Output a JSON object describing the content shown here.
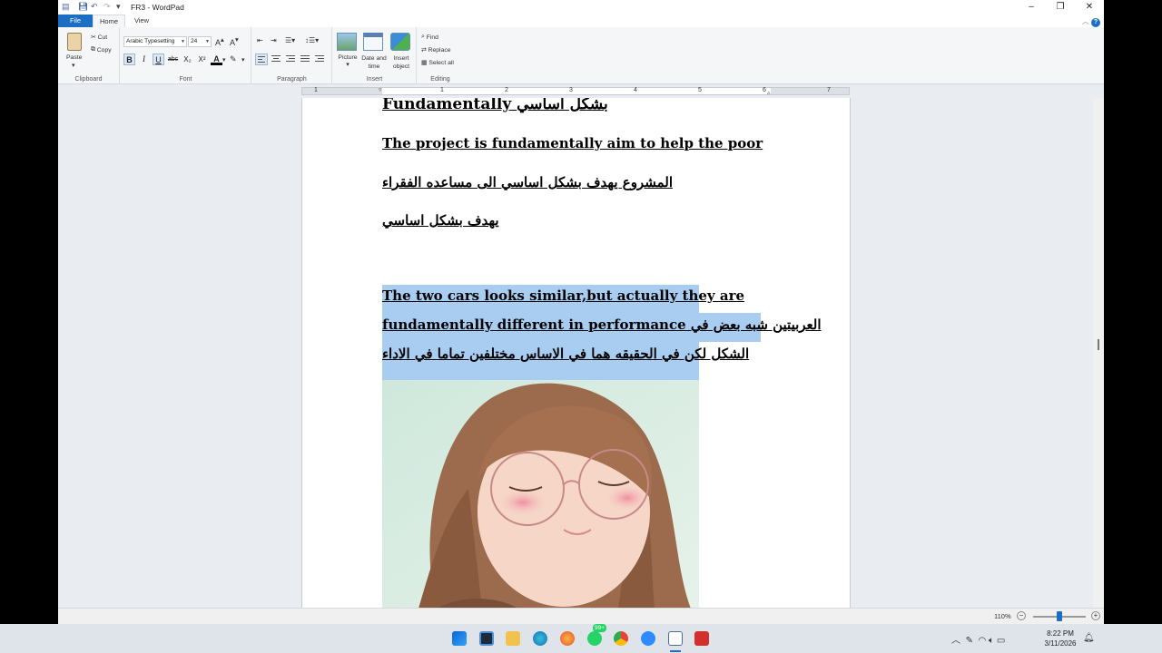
{
  "window": {
    "title": "FR3 - WordPad",
    "controls": {
      "minimize": "–",
      "maximize": "❐",
      "close": "✕"
    }
  },
  "tabs": {
    "file": "File",
    "home": "Home",
    "view": "View"
  },
  "ribbon": {
    "clipboard": {
      "label": "Clipboard",
      "paste": "Paste",
      "cut": "Cut",
      "copy": "Copy"
    },
    "font": {
      "label": "Font",
      "family": "Arabic Typesetting",
      "size": "24",
      "bold": "B",
      "italic": "I",
      "underline": "U",
      "strikethrough": "abc",
      "subscript": "X₂",
      "superscript": "X²",
      "font_color": "A"
    },
    "paragraph": {
      "label": "Paragraph"
    },
    "insert": {
      "label": "Insert",
      "picture": "Picture",
      "datetime_line1": "Date and",
      "datetime_line2": "time",
      "object_line1": "Insert",
      "object_line2": "object"
    },
    "editing": {
      "label": "Editing",
      "find": "Find",
      "replace": "Replace",
      "select_all": "Select all"
    }
  },
  "ruler": {
    "marks": [
      "1",
      "1",
      "2",
      "3",
      "4",
      "5",
      "6",
      "7"
    ]
  },
  "document": {
    "lines": [
      {
        "text": "Fundamentally بشكل اساسي",
        "selected": false
      },
      {
        "text": "The project is fundamentally aim to help the poor",
        "selected": false
      },
      {
        "text": "المشروع يهدف بشكل اساسي الى مساعده الفقراء",
        "selected": false
      },
      {
        "text": "يهدف بشكل اساسي",
        "selected": false
      },
      {
        "text": "The two cars looks similar,but actually they are",
        "selected": true
      },
      {
        "text": "fundamentally different in performance  العربيتين شبه بعض في",
        "selected": true
      },
      {
        "text": "الشكل لكن في الحقيقه هما في الاساس مختلفين تماما في الاداء",
        "selected": true
      }
    ]
  },
  "status": {
    "zoom": "110%",
    "zoom_fraction": 0.5
  },
  "taskbar": {
    "badge": "99+",
    "time": "8:22 PM",
    "date": "3/11/2026"
  },
  "colors": {
    "accent": "#1b6ec2",
    "selection": "#a8cdf0"
  }
}
